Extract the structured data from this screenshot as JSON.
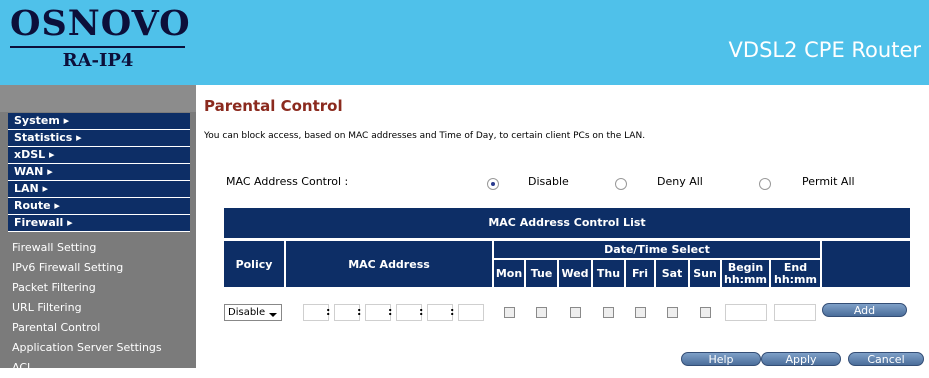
{
  "brand": {
    "logo": "OSNOVO",
    "model": "RA-IP4",
    "product": "VDSL2 CPE Router"
  },
  "menu": {
    "sections": [
      "System ▸",
      "Statistics ▸",
      "xDSL ▸",
      "WAN ▸",
      "LAN ▸",
      "Route ▸",
      "Firewall ▸"
    ],
    "firewall_items": [
      "Firewall Setting",
      "IPv6 Firewall Setting",
      "Packet Filtering",
      "URL Filtering",
      "Parental Control",
      "Application Server Settings",
      "ACL"
    ]
  },
  "page": {
    "title": "Parental Control",
    "description": "You can block access, based on MAC addresses and Time of Day, to certain client PCs on the LAN."
  },
  "mac_control": {
    "label": "MAC Address Control :",
    "options": [
      "Disable",
      "Deny All",
      "Permit All"
    ],
    "selected": "Disable"
  },
  "table": {
    "title": "MAC Address Control List",
    "headers": {
      "policy": "Policy",
      "mac": "MAC Address",
      "datetime": "Date/Time Select",
      "days": [
        "Mon",
        "Tue",
        "Wed",
        "Thu",
        "Fri",
        "Sat",
        "Sun"
      ],
      "begin": [
        "Begin",
        "hh:mm"
      ],
      "end": [
        "End",
        "hh:mm"
      ]
    },
    "row": {
      "policy": "Disable",
      "add": "Add"
    }
  },
  "buttons": {
    "help": "Help",
    "apply": "Apply",
    "cancel": "Cancel"
  },
  "colors": {
    "header": "#4fc1ea",
    "nav": "#0d2e66",
    "sidebar": "#7b7b7b",
    "title": "#8b2a1e"
  }
}
